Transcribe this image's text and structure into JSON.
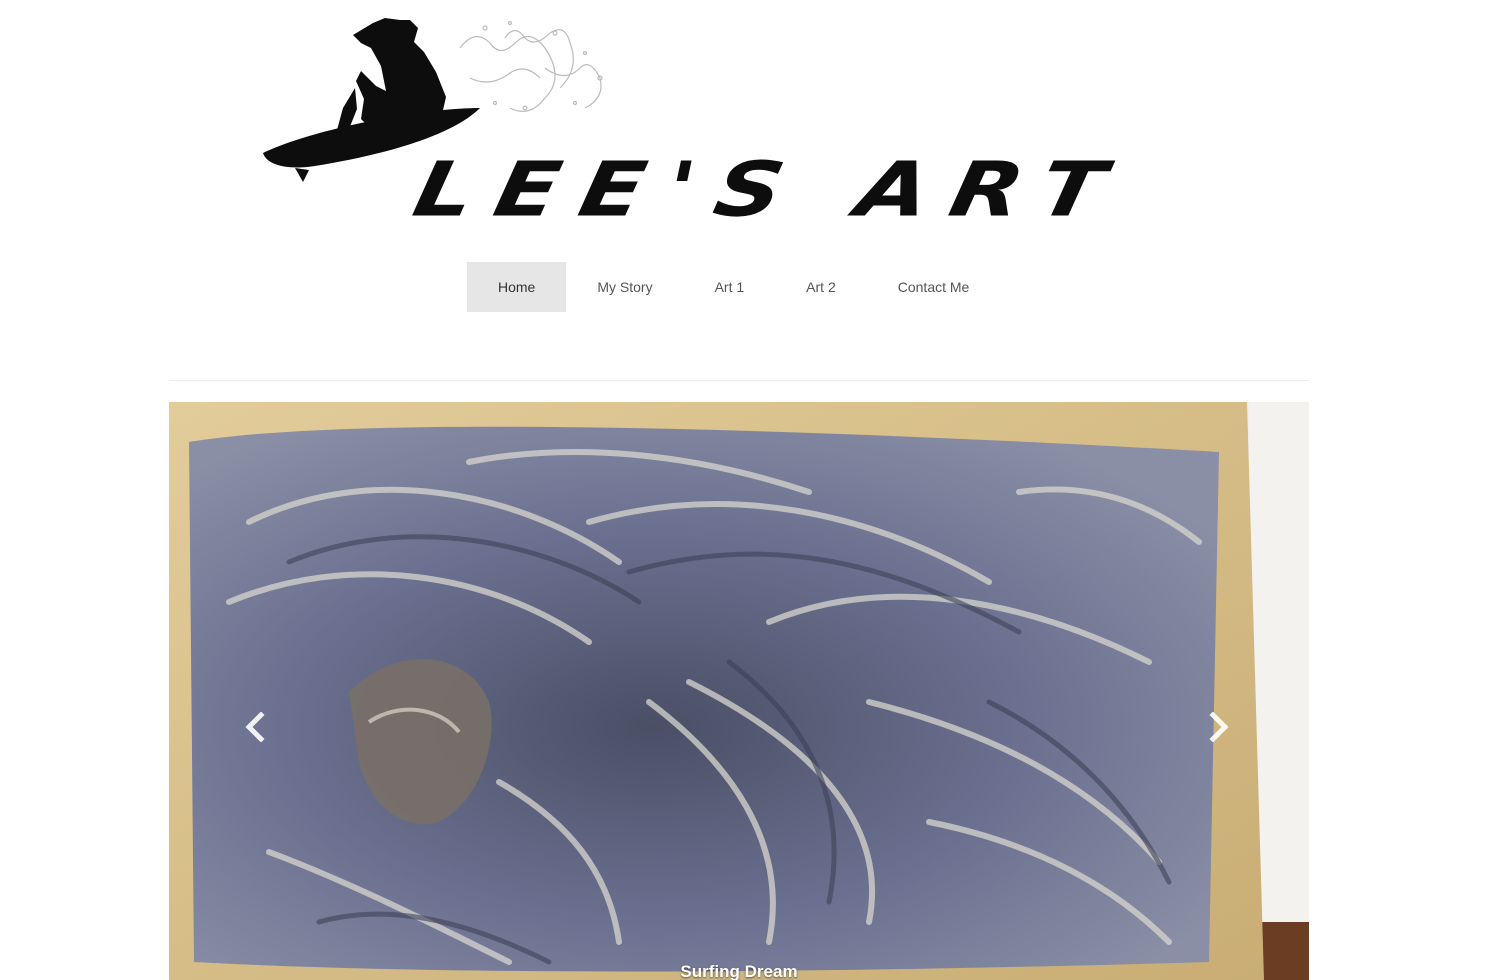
{
  "brand": {
    "logo_text": "LEE'S ART"
  },
  "nav": {
    "items": [
      {
        "label": "Home",
        "active": true
      },
      {
        "label": "My Story",
        "active": false
      },
      {
        "label": "Art 1",
        "active": false
      },
      {
        "label": "Art 2",
        "active": false
      },
      {
        "label": "Contact Me",
        "active": false
      }
    ]
  },
  "carousel": {
    "caption": "Surfing Dream",
    "prev_icon": "chevron-left-icon",
    "next_icon": "chevron-right-icon"
  },
  "colors": {
    "nav_active_bg": "#e6e6e6",
    "nav_text": "#555555",
    "logo": "#0d0d0d",
    "painting_blue": "#5e6480",
    "board_wood": "#d9c08c"
  }
}
